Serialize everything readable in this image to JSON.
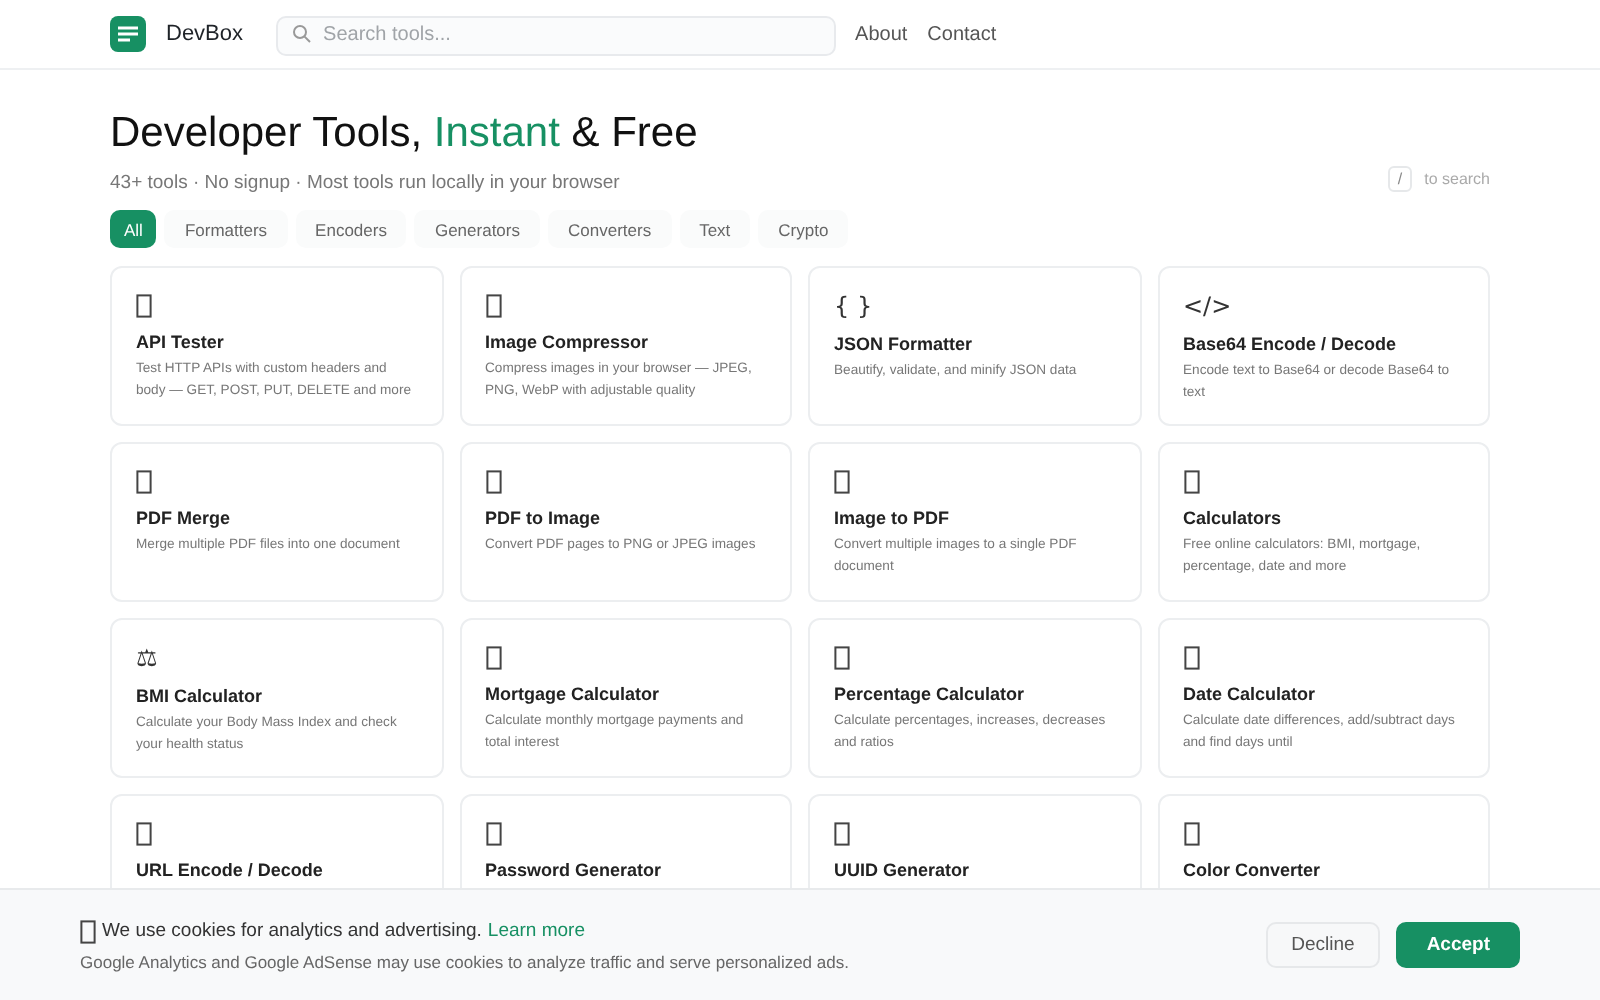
{
  "header": {
    "brand": "DevBox",
    "search": {
      "placeholder": "Search tools..."
    },
    "nav": [
      "About",
      "Contact"
    ]
  },
  "hero": {
    "title": [
      {
        "text": "Developer Tools, ",
        "accent": false
      },
      {
        "text": "Instant",
        "accent": true
      },
      {
        "text": " & Free",
        "accent": false
      }
    ],
    "subtitle": "43+ tools · No signup · Most tools run locally in your browser",
    "shortcut": {
      "key": "/",
      "hint": "to search"
    }
  },
  "filters": [
    {
      "label": "All",
      "selected": true
    },
    {
      "label": "Formatters",
      "selected": false
    },
    {
      "label": "Encoders",
      "selected": false
    },
    {
      "label": "Generators",
      "selected": false
    },
    {
      "label": "Converters",
      "selected": false
    },
    {
      "label": "Text",
      "selected": false
    },
    {
      "label": "Crypto",
      "selected": false
    }
  ],
  "tools": [
    {
      "kind": "missing",
      "title": "API Tester",
      "description": "Test HTTP APIs with custom headers and body — GET, POST, PUT, DELETE and more"
    },
    {
      "kind": "missing",
      "title": "Image Compressor",
      "description": "Compress images in your browser — JPEG, PNG, WebP with adjustable quality"
    },
    {
      "kind": "glyph",
      "glyph": "{ }",
      "title": "JSON Formatter",
      "description": "Beautify, validate, and minify JSON data"
    },
    {
      "kind": "glyph",
      "glyph": "</>",
      "title": "Base64 Encode / Decode",
      "description": "Encode text to Base64 or decode Base64 to text"
    },
    {
      "kind": "missing",
      "title": "PDF Merge",
      "description": "Merge multiple PDF files into one document"
    },
    {
      "kind": "missing",
      "title": "PDF to Image",
      "description": "Convert PDF pages to PNG or JPEG images"
    },
    {
      "kind": "missing",
      "title": "Image to PDF",
      "description": "Convert multiple images to a single PDF document"
    },
    {
      "kind": "missing",
      "title": "Calculators",
      "description": "Free online calculators: BMI, mortgage, percentage, date and more"
    },
    {
      "kind": "glyph",
      "glyph": "⚖",
      "title": "BMI Calculator",
      "description": "Calculate your Body Mass Index and check your health status"
    },
    {
      "kind": "missing",
      "title": "Mortgage Calculator",
      "description": "Calculate monthly mortgage payments and total interest"
    },
    {
      "kind": "missing",
      "title": "Percentage Calculator",
      "description": "Calculate percentages, increases, decreases and ratios"
    },
    {
      "kind": "missing",
      "title": "Date Calculator",
      "description": "Calculate date differences, add/subtract days and find days until"
    },
    {
      "kind": "missing",
      "title": "URL Encode / Decode"
    },
    {
      "kind": "missing",
      "title": "Password Generator"
    },
    {
      "kind": "missing",
      "title": "UUID Generator"
    },
    {
      "kind": "missing",
      "title": "Color Converter"
    }
  ],
  "cookie_banner": {
    "message": "We use cookies for analytics and advertising.",
    "link": "Learn more",
    "detail": "Google Analytics and Google AdSense may use cookies to analyze traffic and serve personalized ads.",
    "buttons": [
      {
        "label": "Decline",
        "kind": "secondary"
      },
      {
        "label": "Accept",
        "kind": "primary"
      }
    ]
  }
}
